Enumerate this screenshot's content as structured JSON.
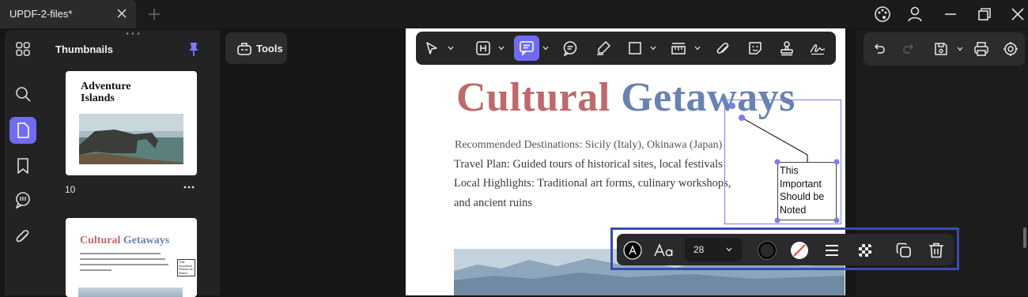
{
  "tab": {
    "title": "UPDF-2-files*"
  },
  "window_controls": [
    "theme-icon",
    "account-icon",
    "minimize-icon",
    "restore-icon",
    "close-icon"
  ],
  "left_rail": [
    "thumbnails-icon",
    "search-icon",
    "page-icon",
    "bookmark-icon",
    "comments-icon",
    "attachment-icon"
  ],
  "thumbnails": {
    "title": "Thumbnails",
    "page1": {
      "title_line1": "Adventure",
      "title_line2": "Islands",
      "number": "10"
    },
    "page2": {
      "title_red": "Cultural",
      "title_blue": "Getaways",
      "note": "This Important Should be Noted"
    }
  },
  "tools": {
    "label": "Tools"
  },
  "toolbar_icons": [
    "select-icon",
    "text-box-icon",
    "callout-icon",
    "comment-icon",
    "highlighter-icon",
    "rectangle-icon",
    "measure-icon",
    "attach-icon",
    "sticker-icon",
    "stamp-icon",
    "signature-icon"
  ],
  "document": {
    "title_red": "Cultural",
    "title_blue": "Getaways",
    "line1": "Recommended Destinations: Sicily (Italy), Okinawa (Japan)",
    "line2": "Travel Plan: Guided tours of historical sites, local festivals",
    "line3": "Local Highlights: Traditional art forms, culinary workshops,",
    "line4": "and ancient ruins",
    "callout": {
      "line1": "This",
      "line2": "Important",
      "line3": "Should be",
      "line4": "Noted"
    }
  },
  "properties_bar": {
    "font_size": "28",
    "icons": [
      "font-color-icon",
      "font-style-icon",
      "border-color-icon",
      "fill-color-icon",
      "line-style-icon",
      "opacity-icon",
      "duplicate-icon",
      "delete-icon"
    ]
  },
  "colors": {
    "accent": "#6f6cf0",
    "title_red": "#c0686a",
    "title_blue": "#6982b2",
    "frame": "#3a4bb5"
  }
}
